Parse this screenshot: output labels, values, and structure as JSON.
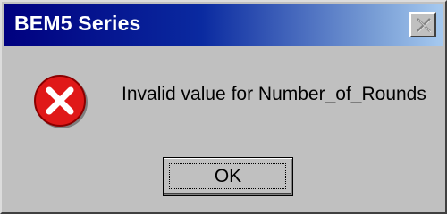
{
  "window": {
    "title": "BEM5 Series",
    "close_icon": "close-icon"
  },
  "dialog": {
    "icon": "error-icon",
    "message": "Invalid value for Number_of_Rounds",
    "ok_label": "OK"
  },
  "colors": {
    "titlebar_start": "#00007f",
    "titlebar_end": "#a6caf0",
    "face": "#c0c0c0",
    "error_red": "#e01818"
  }
}
